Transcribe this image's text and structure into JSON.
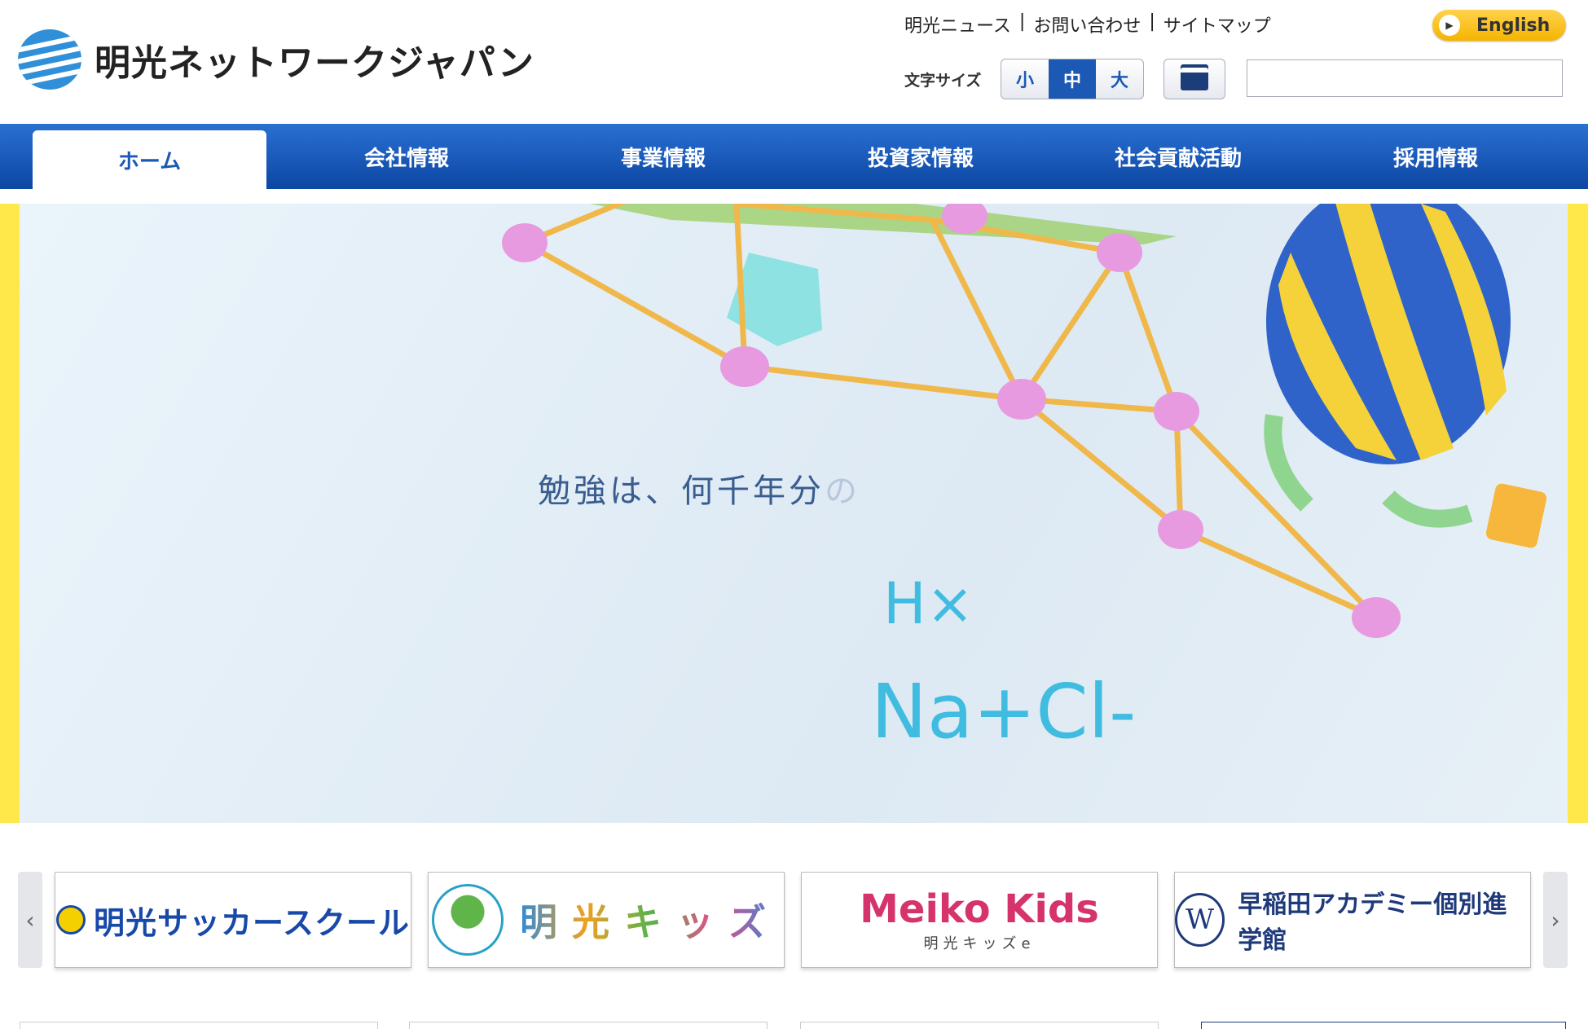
{
  "header": {
    "logo_text": "明光ネットワークジャパン",
    "top_links": [
      "明光ニュース",
      "お問い合わせ",
      "サイトマップ"
    ],
    "english_label": "English",
    "font_size_label": "文字サイズ",
    "font_sizes": [
      "小",
      "中",
      "大"
    ],
    "font_size_selected": "中",
    "search_value": ""
  },
  "nav": {
    "tabs": [
      "ホーム",
      "会社情報",
      "事業情報",
      "投資家情報",
      "社会貢献活動",
      "採用情報"
    ],
    "active": "ホーム"
  },
  "hero": {
    "copy_main": "勉強は、何千年分",
    "copy_fade": "の",
    "chem_line1": "H×",
    "chem_line2": "Na+Cl-"
  },
  "banners": [
    {
      "text": "明光サッカースクール"
    },
    {
      "text": "明光キッズ"
    },
    {
      "text": "Meiko Kids",
      "sub": "明光キッズe"
    },
    {
      "text": "早稲田アカデミー個別進学館",
      "seal": "W"
    }
  ],
  "carousel": {
    "prev": "‹",
    "next": "›"
  },
  "colors": {
    "nav_blue": "#1b59b5",
    "accent_yellow": "#ffe84a"
  }
}
